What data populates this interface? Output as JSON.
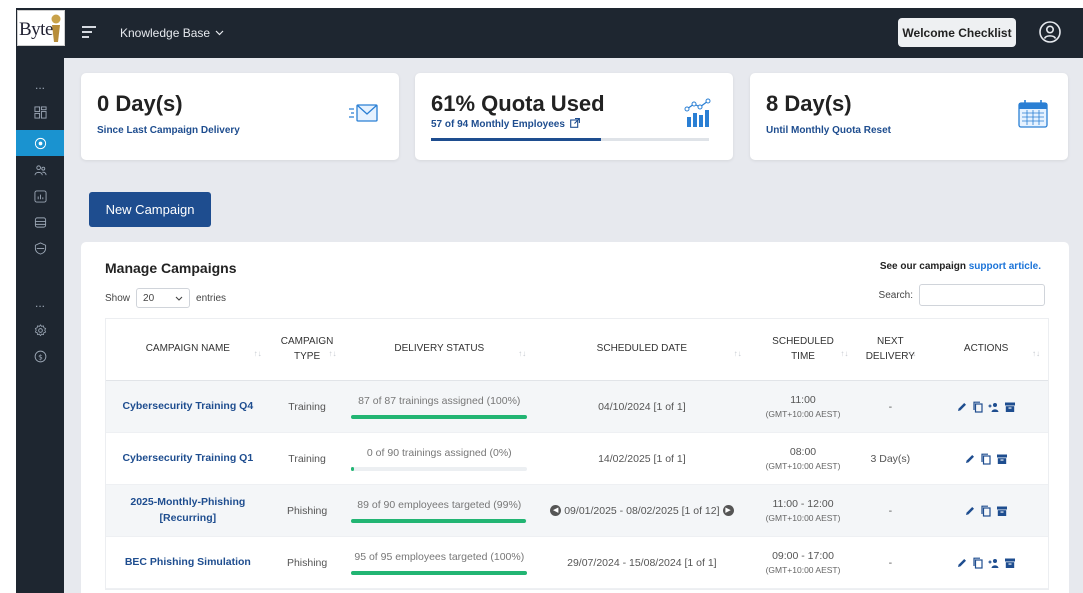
{
  "brand": {
    "logo_text": "Byte"
  },
  "header": {
    "menu_label": "Knowledge Base",
    "welcome_label": "Welcome Checklist"
  },
  "sidebar": {
    "items": [
      {
        "icon": "more-dots-icon",
        "label": "..."
      },
      {
        "icon": "dashboard-grid-icon"
      },
      {
        "icon": "campaign-target-icon",
        "active": true
      },
      {
        "icon": "users-icon"
      },
      {
        "icon": "reports-chart-icon"
      },
      {
        "icon": "database-icon"
      },
      {
        "icon": "shield-icon"
      },
      {
        "icon": "more-dots-icon",
        "label": "..."
      },
      {
        "icon": "settings-gear-icon"
      },
      {
        "icon": "billing-dollar-icon"
      }
    ]
  },
  "stats": {
    "last_delivery": {
      "value": "0 Day(s)",
      "label": "Since Last Campaign Delivery"
    },
    "quota": {
      "value": "61% Quota Used",
      "label": "57 of 94 Monthly Employees",
      "progress": 0.61
    },
    "reset": {
      "value": "8 Day(s)",
      "label": "Until Monthly Quota Reset"
    }
  },
  "new_campaign_label": "New Campaign",
  "manage": {
    "title": "Manage Campaigns",
    "support_prefix": "See our campaign ",
    "support_link": "support article.",
    "show_label": "Show",
    "entries_value": "20",
    "entries_label": "entries",
    "search_label": "Search:"
  },
  "table": {
    "headers": {
      "name": "CAMPAIGN NAME",
      "type_line1": "CAMPAIGN",
      "type_line2": "TYPE",
      "status": "DELIVERY STATUS",
      "date": "SCHEDULED DATE",
      "time_line1": "SCHEDULED",
      "time_line2": "TIME",
      "next_line1": "NEXT",
      "next_line2": "DELIVERY",
      "actions": "ACTIONS"
    },
    "rows": [
      {
        "name": "Cybersecurity Training Q4",
        "type": "Training",
        "status": "87 of 87 trainings assigned (100%)",
        "progress": 1.0,
        "date": "04/10/2024 [1 of 1]",
        "time": "11:00",
        "tz": "(GMT+10:00 AEST)",
        "next": "-"
      },
      {
        "name": "Cybersecurity Training Q1",
        "type": "Training",
        "status": "0 of 90 trainings assigned (0%)",
        "progress": 0.0,
        "date": "14/02/2025 [1 of 1]",
        "time": "08:00",
        "tz": "(GMT+10:00 AEST)",
        "next": "3 Day(s)"
      },
      {
        "name": "2025-Monthly-Phishing [Recurring]",
        "type": "Phishing",
        "status": "89 of 90 employees targeted (99%)",
        "progress": 0.99,
        "date": "09/01/2025 - 08/02/2025 [1 of 12]",
        "time": "11:00 - 12:00",
        "tz": "(GMT+10:00 AEST)",
        "next": "-"
      },
      {
        "name": "BEC Phishing Simulation",
        "type": "Phishing",
        "status": "95 of 95 employees targeted (100%)",
        "progress": 1.0,
        "date": "29/07/2024 - 15/08/2024 [1 of 1]",
        "time": "09:00 - 17:00",
        "tz": "(GMT+10:00 AEST)",
        "next": "-"
      }
    ]
  },
  "colors": {
    "topbar": "#1e2630",
    "accent": "#1e4d8f",
    "active_sidebar": "#1a93d0",
    "progress_green": "#22b573"
  }
}
